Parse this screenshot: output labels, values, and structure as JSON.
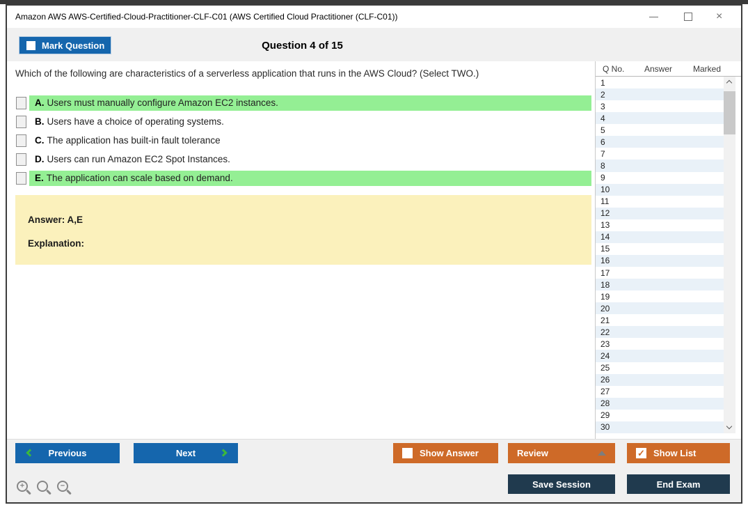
{
  "window": {
    "title": "Amazon AWS AWS-Certified-Cloud-Practitioner-CLF-C01 (AWS Certified Cloud Practitioner (CLF-C01))",
    "close_glyph": "×"
  },
  "header": {
    "mark_question_label": "Mark Question",
    "question_counter": "Question 4 of 15"
  },
  "question": {
    "text": "Which of the following are characteristics of a serverless application that runs in the AWS Cloud? (Select TWO.)",
    "options": [
      {
        "letter": "A.",
        "text": "Users must manually configure Amazon EC2 instances.",
        "highlighted": true,
        "checked": false
      },
      {
        "letter": "B.",
        "text": "Users have a choice of operating systems.",
        "highlighted": false,
        "checked": false
      },
      {
        "letter": "C.",
        "text": "The application has built-in fault tolerance",
        "highlighted": false,
        "checked": false
      },
      {
        "letter": "D.",
        "text": "Users can run Amazon EC2 Spot Instances.",
        "highlighted": false,
        "checked": false
      },
      {
        "letter": "E.",
        "text": "The application can scale based on demand.",
        "highlighted": true,
        "checked": false
      }
    ],
    "answer_label": "Answer: A,E",
    "explanation_label": "Explanation:"
  },
  "question_list": {
    "columns": {
      "qno": "Q No.",
      "answer": "Answer",
      "marked": "Marked"
    },
    "rows": [
      "1",
      "2",
      "3",
      "4",
      "5",
      "6",
      "7",
      "8",
      "9",
      "10",
      "11",
      "12",
      "13",
      "14",
      "15",
      "16",
      "17",
      "18",
      "19",
      "20",
      "21",
      "22",
      "23",
      "24",
      "25",
      "26",
      "27",
      "28",
      "29",
      "30"
    ]
  },
  "footer": {
    "previous_label": "Previous",
    "next_label": "Next",
    "show_answer_label": "Show Answer",
    "show_answer_checked": false,
    "review_label": "Review",
    "show_list_label": "Show List",
    "show_list_checked": true,
    "check_glyph": "✓",
    "save_session_label": "Save Session",
    "end_exam_label": "End Exam",
    "zoom_in_sign": "+",
    "zoom_out_sign": "−"
  },
  "colors": {
    "accent_blue": "#1566ad",
    "accent_orange": "#ce6a28",
    "dark_navy": "#203a4e",
    "highlight_green": "#94ef94",
    "answer_yellow": "#fbf1bc",
    "row_stripe_blue": "#e9f1f8",
    "chevron_green": "#3cb83c"
  }
}
